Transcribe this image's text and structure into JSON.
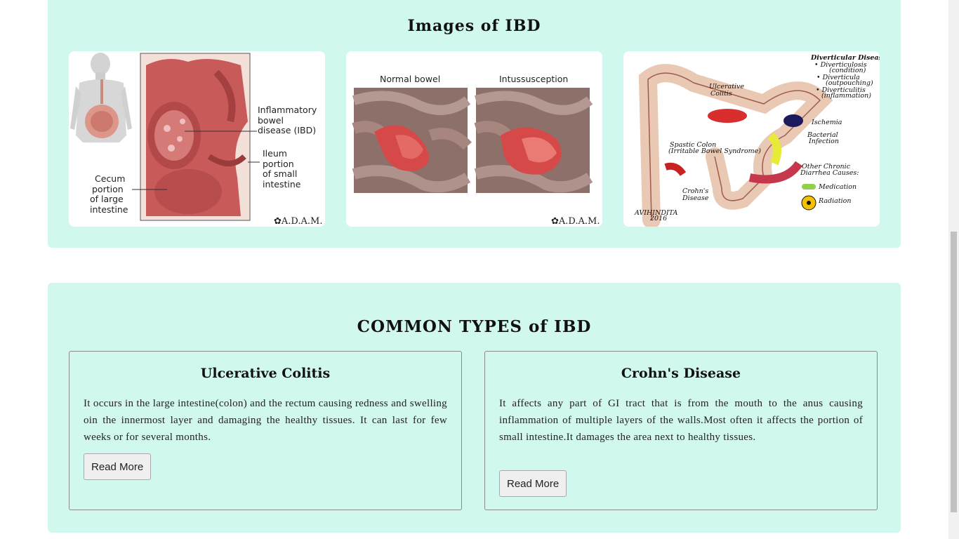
{
  "images_section": {
    "title": "Images of IBD",
    "image1": {
      "labels": [
        "Inflammatory",
        "bowel",
        "disease (IBD)",
        "Ileum",
        "portion",
        "of small",
        "intestine",
        "Cecum",
        "portion",
        "of large",
        "intestine"
      ],
      "brand": "A.D.A.M."
    },
    "image2": {
      "left_caption": "Normal bowel",
      "right_caption": "Intussusception",
      "brand": "A.D.A.M."
    },
    "image3": {
      "labels": {
        "title": "Diverticular Disease",
        "d1": "• Diverticulosis",
        "d1b": "(condition)",
        "d2": "• Diverticula",
        "d2b": "(outpouching)",
        "d3": "• Diverticulitis",
        "d3b": "(inflammation)",
        "uc1": "Ulcerative",
        "uc2": "Colitis",
        "ischemia": "Ischemia",
        "bact1": "Bacterial",
        "bact2": "Infection",
        "spastic1": "Spastic Colon",
        "spastic2": "(Irritable Bowel Syndrome)",
        "crohns1": "Crohn's",
        "crohns2": "Disease",
        "other1": "Other Chronic",
        "other2": "Diarrhea Causes:",
        "medication": "Medication",
        "radiation": "Radiation",
        "sig1": "AVIHINDITA",
        "sig2": "2016"
      }
    }
  },
  "types_section": {
    "title": "COMMON TYPES of IBD",
    "cards": [
      {
        "title": "Ulcerative Colitis",
        "text": "It occurs in the large intestine(colon) and the rectum causing redness and swelling oin the innermost layer and damaging the healthy tissues. It can last for few weeks or for several months.",
        "button": "Read More"
      },
      {
        "title": "Crohn's Disease",
        "text": "It affects any part of GI tract that is from the mouth to the anus causing inflammation of multiple layers of the walls.Most often it affects the portion of small intestine.It damages the area next to healthy tissues.",
        "button": "Read More"
      }
    ]
  },
  "colors": {
    "panel_bg": "#d0f8ef",
    "card_border": "#8a8a8a",
    "button_bg": "#efefef"
  }
}
